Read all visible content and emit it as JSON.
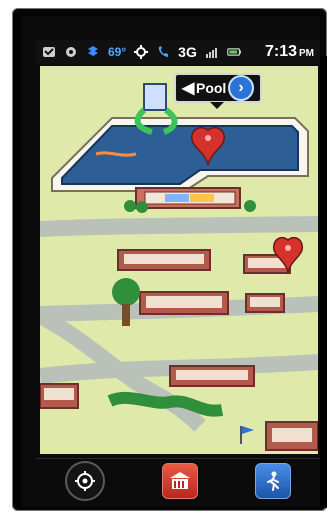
{
  "status_bar": {
    "temperature": "69°",
    "network": "3G",
    "time": "7:13",
    "ampm": "PM"
  },
  "map": {
    "callout": {
      "label": "Pool"
    }
  },
  "bottom_bar": {
    "buttons": [
      {
        "icon": "locate-icon"
      },
      {
        "icon": "buildings-icon"
      },
      {
        "icon": "walking-person-icon"
      }
    ]
  },
  "colors": {
    "map_bg": "#dfe9a9",
    "road": "#b9c1b8",
    "pool_water": "#2d5f96",
    "pin_red": "#d6312c",
    "accent_blue": "#2a74d6"
  }
}
